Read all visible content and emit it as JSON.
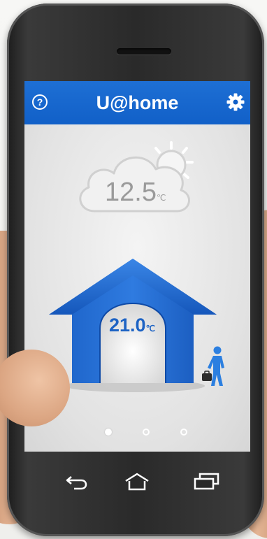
{
  "app": {
    "title": "U@home",
    "help_glyph": "?"
  },
  "weather": {
    "outdoor_temp": "12.5",
    "unit": "℃",
    "icon": "cloud-sun-icon"
  },
  "home": {
    "indoor_temp": "21.0",
    "unit": "℃",
    "heating_icon": "flame-icon",
    "presence_icon": "person-leaving-icon"
  },
  "pager": {
    "total": 3,
    "active_index": 0
  },
  "nav": {
    "back_icon": "back-icon",
    "home_icon": "home-icon",
    "recent_icon": "recent-apps-icon"
  },
  "colors": {
    "accent": "#1160c8",
    "house": "#1b67d1",
    "flame": "#e8462a",
    "temp_text": "#1d63c4"
  }
}
